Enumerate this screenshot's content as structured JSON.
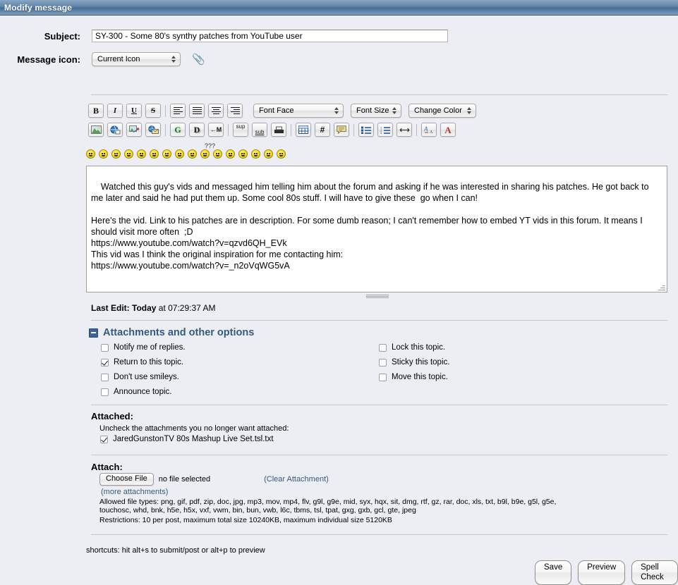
{
  "window": {
    "title": "Modify message"
  },
  "form": {
    "subject_label": "Subject:",
    "subject_value": "SY-300 - Some 80's synthy patches from YouTube user",
    "message_icon_label": "Message icon:",
    "message_icon_value": "Current Icon",
    "attachment_clip_icon": "paperclip-icon"
  },
  "toolbar": {
    "row1": [
      {
        "name": "bold-button",
        "glyph": "B",
        "style": "bold"
      },
      {
        "name": "italic-button",
        "glyph": "I",
        "style": "italic"
      },
      {
        "name": "underline-button",
        "glyph": "U",
        "style": "underline"
      },
      {
        "name": "strikethrough-button",
        "glyph": "S",
        "style": "strike"
      }
    ],
    "aligns": [
      {
        "name": "align-left-button",
        "glyph": "align-left-icon"
      },
      {
        "name": "align-justify-button",
        "glyph": "align-justify-icon"
      },
      {
        "name": "align-center-button",
        "glyph": "align-center-icon"
      },
      {
        "name": "align-right-button",
        "glyph": "align-right-icon"
      }
    ],
    "font_face": "Font Face",
    "font_size": "Font Size",
    "change_color": "Change Color",
    "row2": [
      {
        "name": "insert-image-button",
        "glyph": "image-icon"
      },
      {
        "name": "insert-link-button",
        "glyph": "globe-link-icon"
      },
      {
        "name": "insert-hosted-image-button",
        "glyph": "image-link-icon"
      },
      {
        "name": "insert-email-button",
        "glyph": "globe-mail-icon"
      },
      {
        "name": "glow-text-button",
        "glyph": "G"
      },
      {
        "name": "shadow-text-button",
        "glyph": "D"
      },
      {
        "name": "marquee-button",
        "glyph": "←M"
      },
      {
        "name": "superscript-button",
        "glyph": "sup"
      },
      {
        "name": "subscript-button",
        "glyph": "sub"
      },
      {
        "name": "teletype-button",
        "glyph": "typewriter-icon"
      },
      {
        "name": "insert-table-button",
        "glyph": "table-icon"
      },
      {
        "name": "insert-code-button",
        "glyph": "#"
      },
      {
        "name": "insert-quote-button",
        "glyph": "quote-icon"
      },
      {
        "name": "bullet-list-button",
        "glyph": "bullet-list-icon"
      },
      {
        "name": "numbered-list-button",
        "glyph": "numbered-list-icon"
      },
      {
        "name": "horizontal-rule-button",
        "glyph": "horizontal-rule-icon"
      },
      {
        "name": "toggle-view-button",
        "glyph": "toggle-source-icon"
      },
      {
        "name": "font-color-button",
        "glyph": "A"
      }
    ]
  },
  "smileys": {
    "count": 16,
    "label": "smiley-palette"
  },
  "message": {
    "body": "Watched this guy's vids and messaged him telling him about the forum and asking if he was interested in sharing his patches. He got back to me later and said he had put them up. Some cool 80s stuff. I will have to give these  go when I can!\n\nHere's the vid. Link to his patches are in description. For some dumb reason; I can't remember how to embed YT vids in this forum. It means I should visit more often  ;D\nhttps://www.youtube.com/watch?v=qzvd6QH_EVk\nThis vid was I think the original inspiration for me contacting him:\nhttps://www.youtube.com/watch?v=_n2oVqWG5vA"
  },
  "last_edit": {
    "prefix": "Last Edit: Today",
    "suffix": " at 07:29:37 AM"
  },
  "options": {
    "heading": "Attachments and other options",
    "left": [
      {
        "label": "Notify me of replies.",
        "checked": false,
        "name": "checkbox-notify-replies"
      },
      {
        "label": "Return to this topic.",
        "checked": true,
        "name": "checkbox-return-topic"
      },
      {
        "label": "Don't use smileys.",
        "checked": false,
        "name": "checkbox-no-smileys"
      },
      {
        "label": "Announce topic.",
        "checked": false,
        "name": "checkbox-announce-topic"
      }
    ],
    "right": [
      {
        "label": "Lock this topic.",
        "checked": false,
        "name": "checkbox-lock-topic"
      },
      {
        "label": "Sticky this topic.",
        "checked": false,
        "name": "checkbox-sticky-topic"
      },
      {
        "label": "Move this topic.",
        "checked": false,
        "name": "checkbox-move-topic"
      }
    ]
  },
  "attached": {
    "heading": "Attached:",
    "hint": "Uncheck the attachments you no longer want attached:",
    "file": {
      "label": "JaredGunstonTV 80s Mashup Live Set.tsl.txt",
      "checked": true
    }
  },
  "attach": {
    "heading": "Attach:",
    "choose_button": "Choose File",
    "no_file_text": "no file selected",
    "clear_link": "(Clear Attachment)",
    "more_link": "(more attachments)",
    "allowed_line1": "Allowed file types: png, gif, pdf, zip, doc, jpg, mp3, mov, mp4, flv, g9l, g9e, mid, syx, hqx, sit, dmg, rtf, gz, rar, doc, xls, txt, b9l, b9e, g5l, g5e,",
    "allowed_line2": "touchosc, whd, bnk, h5e, h5x, vxf, vwm, bin, bun, vwb, l6c, tbms, tsl, tpat, gxg, gxb, gcl, gte, jpeg",
    "restrictions": "Restrictions: 10 per post, maximum total size 10240KB, maximum individual size 5120KB"
  },
  "shortcuts": "shortcuts: hit alt+s to submit/post or alt+p to preview",
  "buttons": {
    "save": "Save",
    "preview": "Preview",
    "spell_check": "Spell Check"
  },
  "colors": {
    "accent": "#36597f",
    "titlebar": "#5e82a6",
    "page_bg": "#eceef3"
  }
}
